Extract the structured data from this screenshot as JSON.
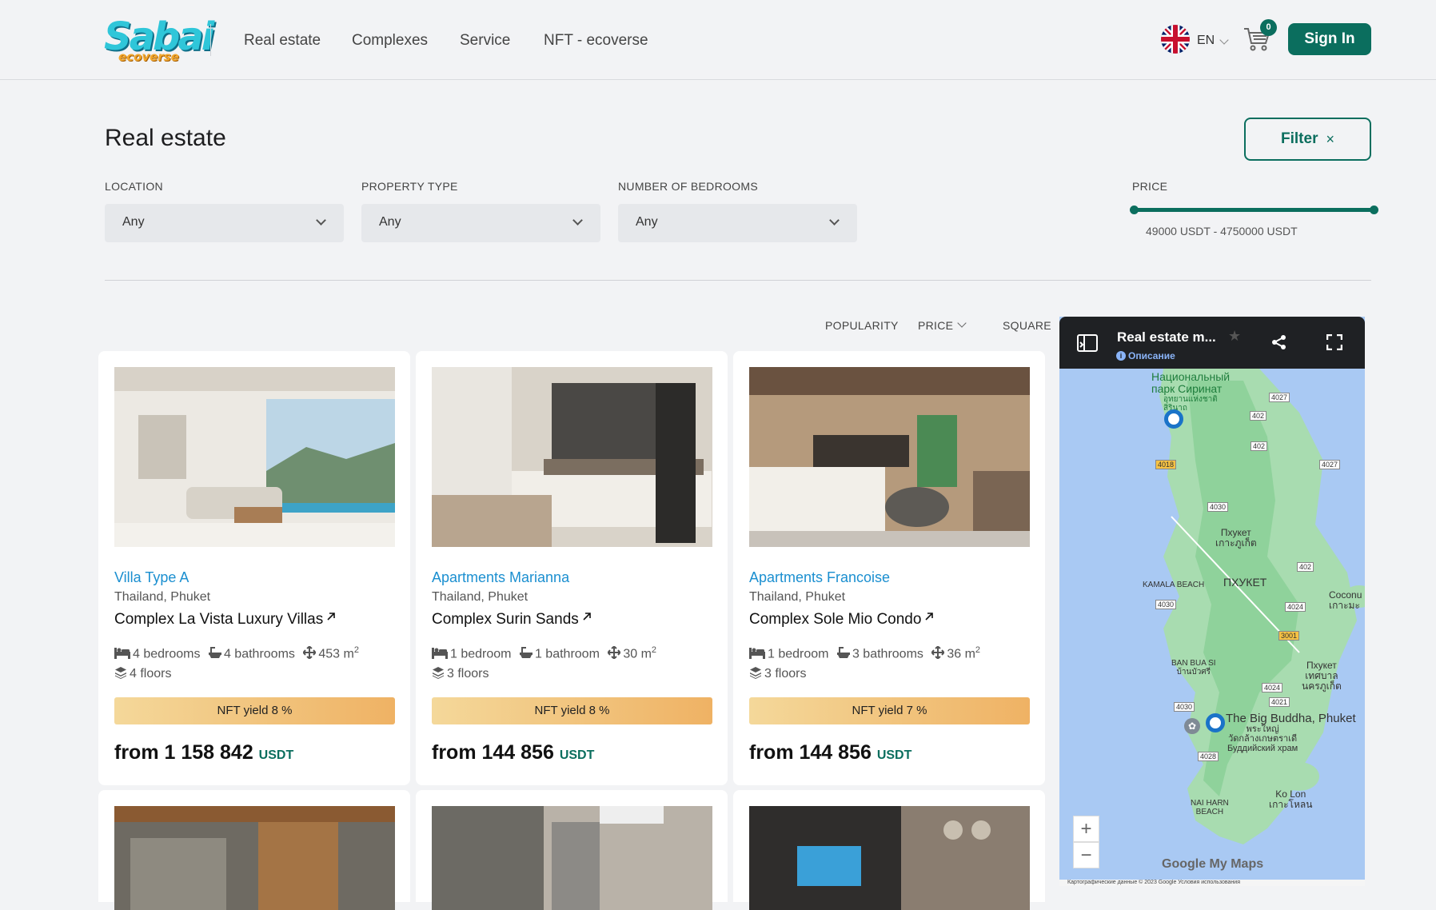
{
  "header": {
    "logo_text": "Sabai",
    "logo_sub": "ecoverse",
    "nav": [
      "Real estate",
      "Complexes",
      "Service",
      "NFT - ecoverse"
    ],
    "lang_code": "EN",
    "cart_count": "0",
    "signin_label": "Sign In"
  },
  "page": {
    "title": "Real estate",
    "filter_label": "Filter",
    "filter_close": "×"
  },
  "filters": {
    "location_label": "LOCATION",
    "location_value": "Any",
    "type_label": "PROPERTY TYPE",
    "type_value": "Any",
    "bedrooms_label": "NUMBER OF BEDROOMS",
    "bedrooms_value": "Any",
    "price_label": "PRICE",
    "price_range": "49000 USDT - 4750000  USDT"
  },
  "sort": {
    "popularity": "POPULARITY",
    "price": "PRICE",
    "square": "SQUARE"
  },
  "cards": [
    {
      "ptype": "Villa Type A",
      "location": "Thailand, Phuket",
      "complex": "Complex La Vista Luxury Villas",
      "bedrooms": "4 bedrooms",
      "bathrooms": "4 bathrooms",
      "area": "453 m",
      "floors": "4 floors",
      "yield": "NFT yield 8 %",
      "price": "from 1 158 842",
      "currency": "USDT"
    },
    {
      "ptype": "Apartments Marianna",
      "location": "Thailand, Phuket",
      "complex": "Complex Surin Sands",
      "bedrooms": "1 bedroom",
      "bathrooms": "1 bathroom",
      "area": "30 m",
      "floors": "3 floors",
      "yield": "NFT yield 8 %",
      "price": "from 144 856",
      "currency": "USDT"
    },
    {
      "ptype": "Apartments Francoise",
      "location": "Thailand, Phuket",
      "complex": "Complex Sole Mio Condo",
      "bedrooms": "1 bedroom",
      "bathrooms": "3 bathrooms",
      "area": "36 m",
      "floors": "3 floors",
      "yield": "NFT yield 7 %",
      "price": "from 144 856",
      "currency": "USDT"
    }
  ],
  "area_sup": "2",
  "map": {
    "title": "Real estate m...",
    "desc": "Описание",
    "labels": {
      "park": "Национальный\nпарк Сиринат",
      "park_th": "อุทยานแห่งชาติ\nสิรินาถ",
      "phuket_town": "Пхукет\nเกาะภูเก็ต",
      "kamala": "KAMALA BEACH",
      "phuket_caps": "ПХУКЕТ",
      "coconut": "Coconu\nเกาะมะ",
      "bansi": "BAN BUA SI\nบ้านบัวศรี",
      "phuket_city": "Пхукет\nเทศบาล\nนครภูเก็ต",
      "big_buddha": "The Big Buddha, Phuket",
      "big_buddha_sub": "พระใหญ่\nวัดกล้างเกษตราเดี\nБуддийский храм",
      "koh_lon": "Ko Lon\nเกาะโหลน",
      "naiharn": "NAI HARN\nBEACH",
      "google": "Google My Maps",
      "copyright": "Картографические данные © 2023 Google    Условия использования"
    },
    "roads": [
      "4027",
      "402",
      "402",
      "4018",
      "4027",
      "4030",
      "402",
      "4030",
      "4024",
      "3001",
      "4024",
      "4021",
      "4030",
      "4028"
    ],
    "zoom_in": "+",
    "zoom_out": "−"
  }
}
